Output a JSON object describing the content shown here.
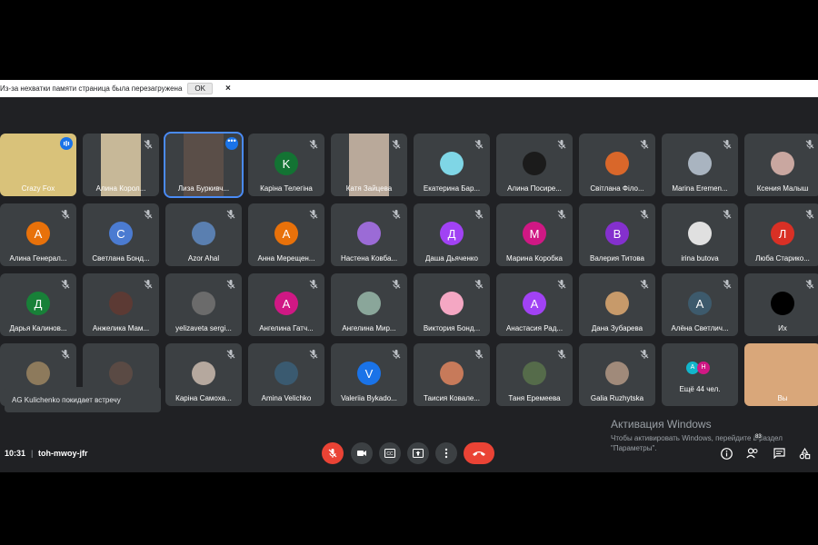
{
  "notice": {
    "text": "Из-за нехватки памяти страница была перезагружена",
    "ok_label": "OK",
    "close_label": "×"
  },
  "participants": [
    {
      "name": "Crazy Fox",
      "type": "video",
      "bg": "#d9c27a",
      "speaking": true
    },
    {
      "name": "Алина Корол...",
      "type": "video",
      "bg": "#c7b898",
      "muted": true
    },
    {
      "name": "Лиза Буркивч...",
      "type": "video",
      "bg": "#5a4e48",
      "highlight": true
    },
    {
      "name": "Каріна Телегіна",
      "type": "letter",
      "letter": "K",
      "color": "#137333",
      "muted": true
    },
    {
      "name": "Катя Зайцева",
      "type": "video",
      "bg": "#b9a99a",
      "muted": true
    },
    {
      "name": "Екатерина Бар...",
      "type": "photo",
      "color": "#7fd6e6",
      "muted": true
    },
    {
      "name": "Алина Посире...",
      "type": "photo",
      "color": "#1b1b1b",
      "muted": true
    },
    {
      "name": "Світлана Філо...",
      "type": "photo",
      "color": "#d9672a",
      "muted": true
    },
    {
      "name": "Marina Eremen...",
      "type": "photo",
      "color": "#a9b4c0",
      "muted": true
    },
    {
      "name": "Ксения Малыш",
      "type": "photo",
      "color": "#c9a7a0",
      "muted": true
    },
    {
      "name": "Алина Генерал...",
      "type": "letter",
      "letter": "А",
      "color": "#e8710a",
      "muted": true
    },
    {
      "name": "Светлана Бонд...",
      "type": "letter",
      "letter": "С",
      "color": "#4b7bd1",
      "muted": true
    },
    {
      "name": "Azor Ahal",
      "type": "photo",
      "color": "#5a7fb0",
      "muted": true
    },
    {
      "name": "Анна Мерещен...",
      "type": "letter",
      "letter": "А",
      "color": "#e8710a",
      "muted": true
    },
    {
      "name": "Настена Ковба...",
      "type": "photo",
      "color": "#9b6bd6",
      "muted": true
    },
    {
      "name": "Даша Дьяченко",
      "type": "letter",
      "letter": "Д",
      "color": "#a142f4",
      "muted": true
    },
    {
      "name": "Марина Коробка",
      "type": "letter",
      "letter": "М",
      "color": "#d01884",
      "muted": true
    },
    {
      "name": "Валерия Титова",
      "type": "letter",
      "letter": "В",
      "color": "#8430ce",
      "muted": true
    },
    {
      "name": "irina butova",
      "type": "photo",
      "color": "#e0e0e0",
      "muted": true
    },
    {
      "name": "Люба Старико...",
      "type": "letter",
      "letter": "Л",
      "color": "#d93025",
      "muted": true
    },
    {
      "name": "Дарья Калинов...",
      "type": "letter",
      "letter": "Д",
      "color": "#188038",
      "muted": true
    },
    {
      "name": "Анжелика Мам...",
      "type": "photo",
      "color": "#5c3a34",
      "muted": true
    },
    {
      "name": "yelizaveta sergi...",
      "type": "photo",
      "color": "#6b6b6b",
      "muted": true
    },
    {
      "name": "Ангелина Гатч...",
      "type": "letter",
      "letter": "А",
      "color": "#d01884",
      "muted": true
    },
    {
      "name": "Ангелина Мир...",
      "type": "photo",
      "color": "#8aa69a",
      "muted": true
    },
    {
      "name": "Виктория Бонд...",
      "type": "photo",
      "color": "#f4a7c3",
      "muted": true
    },
    {
      "name": "Анастасия Рад...",
      "type": "letter",
      "letter": "А",
      "color": "#a142f4",
      "muted": true
    },
    {
      "name": "Дана Зубарева",
      "type": "photo",
      "color": "#c79a6a",
      "muted": true
    },
    {
      "name": "Алёна Светлич...",
      "type": "letter",
      "letter": "А",
      "color": "#3d5a6c",
      "muted": true
    },
    {
      "name": "Их",
      "type": "photo",
      "color": "#000000",
      "muted": true
    },
    {
      "name": "",
      "type": "photo",
      "color": "#8d7a5c",
      "muted": true
    },
    {
      "name": "",
      "type": "photo",
      "color": "#5a4a44",
      "muted": false
    },
    {
      "name": "Каріна Самоха...",
      "type": "photo",
      "color": "#b5a89e",
      "muted": true
    },
    {
      "name": "Amina Velichko",
      "type": "photo",
      "color": "#3a5a70",
      "muted": true
    },
    {
      "name": "Valeriia Bykado...",
      "type": "letter",
      "letter": "V",
      "color": "#1a73e8",
      "muted": true
    },
    {
      "name": "Таисия Ковале...",
      "type": "photo",
      "color": "#c77a5a",
      "muted": true
    },
    {
      "name": "Таня Еремеева",
      "type": "photo",
      "color": "#556b4a",
      "muted": true
    },
    {
      "name": "Galia Ruzhytska",
      "type": "photo",
      "color": "#a08a7a",
      "muted": true
    },
    {
      "name": "Ещё 44 чел.",
      "type": "more",
      "a": "A",
      "b": "H"
    },
    {
      "name": "Вы",
      "type": "video",
      "bg": "#d9a77a"
    }
  ],
  "toast": "AG Kulichenko покидает встречу",
  "activation": {
    "title": "Активация Windows",
    "subtitle": "Чтобы активировать Windows, перейдите в раздел \"Параметры\"."
  },
  "bottom": {
    "time": "10:31",
    "separator": "|",
    "code": "toh-mwoy-jfr",
    "people_count": "83"
  }
}
